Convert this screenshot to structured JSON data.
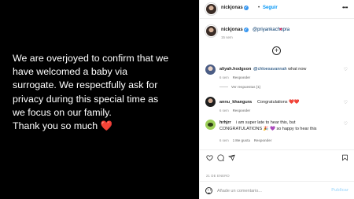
{
  "post": {
    "lines": [
      "We are overjoyed to confirm that we",
      "have welcomed a baby via",
      "surrogate. We respectfully ask for",
      "privacy during this special time as",
      "we focus on our family.",
      "Thank you so much"
    ],
    "heart": "❤️"
  },
  "header": {
    "username": "nickjonas",
    "verified_glyph": "✓",
    "separator": "•",
    "follow_label": "Seguir",
    "more_glyph": "•••"
  },
  "caption": {
    "username": "nickjonas",
    "mention": "@priyankachopra",
    "emoji": "♥",
    "time": "15 sem"
  },
  "load_more_glyph": "+",
  "comments": [
    {
      "username": "aliyah.hodgson",
      "mention": "@chloesavannah",
      "text": " what now",
      "time": "6 sem",
      "reply_label": "Responder",
      "view_replies": "Ver respuestas (1)"
    },
    {
      "username": "annu_khangura",
      "text": "Congratulations ❤️❤️",
      "time": "6 sem",
      "reply_label": "Responder"
    },
    {
      "username": "hrhjrr",
      "text": "i am super late to hear this, but CONGRATULATIONS 🎉 💜 so happy to hear this",
      "time": "6 sem",
      "likes": "1 Me gusta",
      "reply_label": "Responder"
    }
  ],
  "date": "21 DE ENERO",
  "add_comment": {
    "placeholder": "Añade un comentario...",
    "publish_label": "Publicar"
  },
  "icons": {
    "like": "heart-outline-icon",
    "comment": "comment-bubble-icon",
    "share": "paper-plane-icon",
    "save": "bookmark-icon",
    "emoji": "smiley-icon"
  },
  "colors": {
    "link": "#00376b",
    "follow": "#0095f6",
    "muted": "#8e8e8e",
    "publish_disabled": "#b2dffc",
    "heart": "#e0245e"
  }
}
